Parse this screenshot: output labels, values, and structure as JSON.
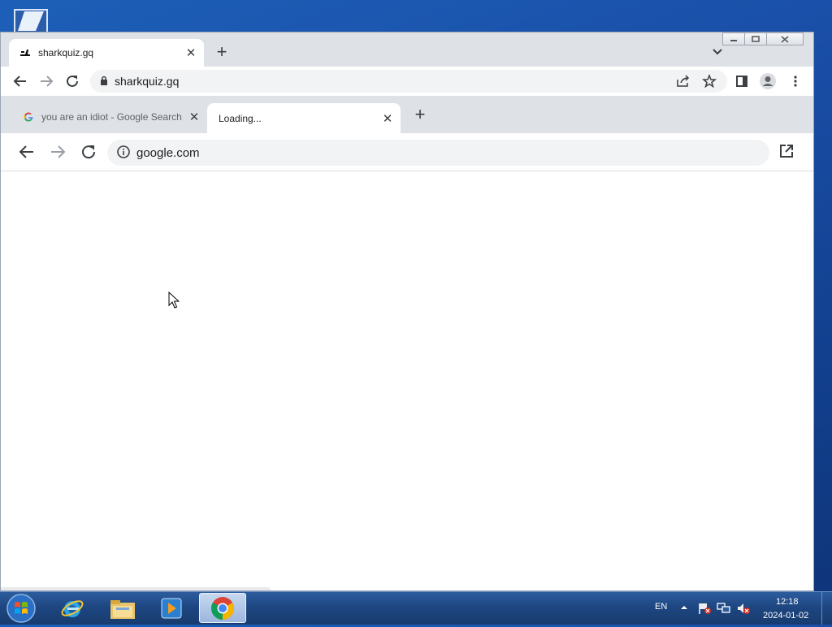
{
  "outer_browser": {
    "tab": {
      "title": "sharkquiz.gq",
      "favicon": "shark-favicon"
    },
    "address": "sharkquiz.gq",
    "icons": [
      "back-icon",
      "forward-icon",
      "reload-icon",
      "lock-icon",
      "share-icon",
      "star-icon",
      "side-panel-icon",
      "profile-icon",
      "menu-icon",
      "tab-search-icon",
      "new-tab-icon"
    ]
  },
  "inner_browser": {
    "tabs": [
      {
        "title": "you are an idiot - Google Search",
        "favicon": "google-g-icon",
        "active": false
      },
      {
        "title": "Loading...",
        "active": true
      }
    ],
    "address": "google.com",
    "icons": [
      "back-icon",
      "forward-icon",
      "reload-icon",
      "info-icon",
      "open-external-icon"
    ]
  },
  "taskbar": {
    "language": "EN",
    "time": "12:18",
    "date": "2024-01-02",
    "apps": [
      "start-orb",
      "internet-explorer",
      "file-explorer",
      "media-player",
      "chrome"
    ],
    "colors": {
      "taskbar": "#1d457f",
      "desktop": "#1a4fa8"
    }
  }
}
